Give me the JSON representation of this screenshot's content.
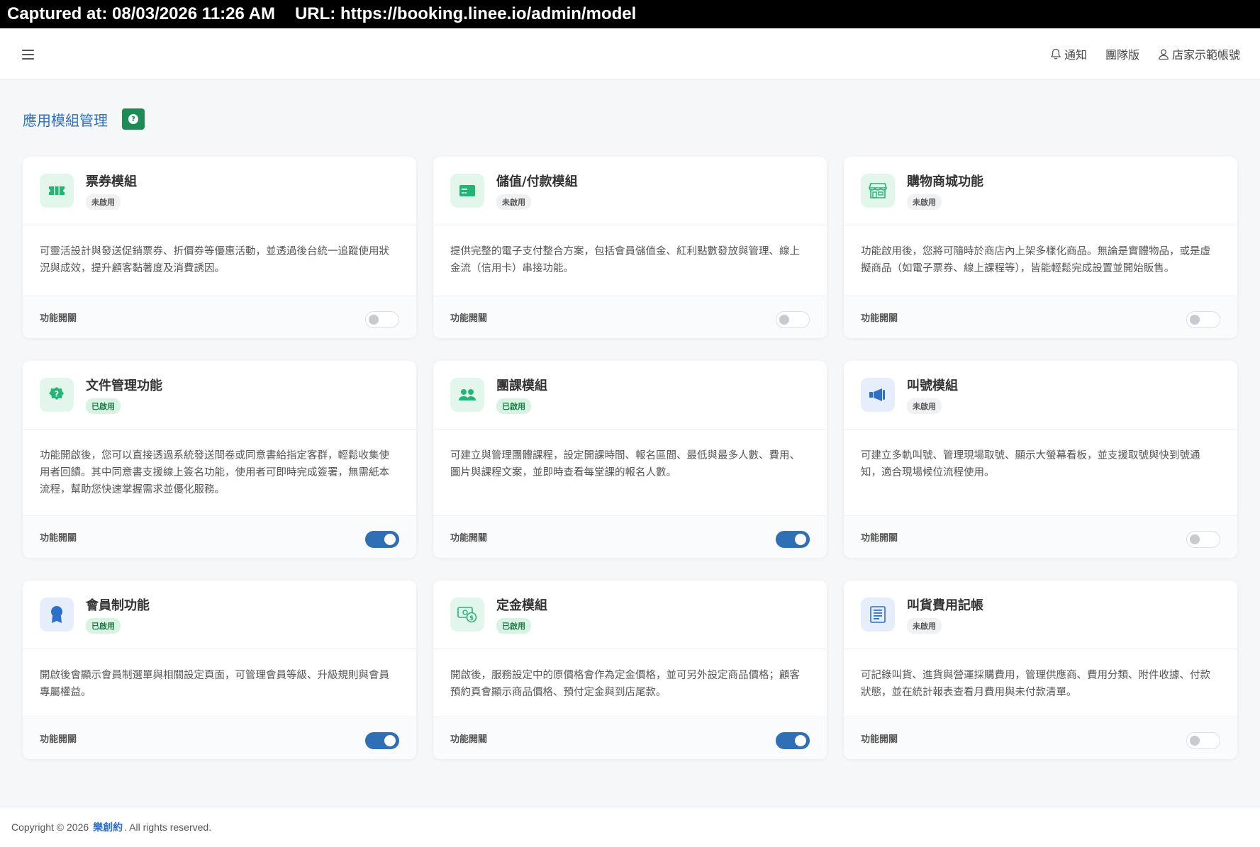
{
  "capture": {
    "captured_at": "Captured at: 08/03/2026 11:26 AM",
    "url": "URL: https://booking.linee.io/admin/model"
  },
  "topbar": {
    "notifications": "通知",
    "team": "團隊版",
    "account": "店家示範帳號"
  },
  "page": {
    "title": "應用模組管理",
    "help": "?"
  },
  "foot_label": "功能開關",
  "modules": [
    {
      "title": "票券模組",
      "status": "未啟用",
      "enabled": false,
      "icon": "ticket-icon",
      "color": "green",
      "desc": "可靈活設計與發送促銷票券、折價券等優惠活動，並透過後台統一追蹤使用狀況與成效，提升顧客黏著度及消費誘因。"
    },
    {
      "title": "儲值/付款模組",
      "status": "未啟用",
      "enabled": false,
      "icon": "payment-card-icon",
      "color": "green",
      "desc": "提供完整的電子支付整合方案，包括會員儲值金、紅利點數發放與管理、線上金流（信用卡）串接功能。"
    },
    {
      "title": "購物商城功能",
      "status": "未啟用",
      "enabled": false,
      "icon": "store-icon",
      "color": "green",
      "desc": "功能啟用後，您將可隨時於商店內上架多樣化商品。無論是實體物品，或是虛擬商品（如電子票券、線上課程等），皆能輕鬆完成設置並開始販售。"
    },
    {
      "title": "文件管理功能",
      "status": "已啟用",
      "enabled": true,
      "icon": "document-badge-icon",
      "color": "green",
      "desc": "功能開啟後，您可以直接透過系統發送問卷或同意書給指定客群，輕鬆收集使用者回饋。其中同意書支援線上簽名功能，使用者可即時完成簽署，無需紙本流程，幫助您快速掌握需求並優化服務。"
    },
    {
      "title": "團課模組",
      "status": "已啟用",
      "enabled": true,
      "icon": "group-users-icon",
      "color": "green",
      "desc": "可建立與管理團體課程，設定開課時間、報名區間、最低與最多人數、費用、圖片與課程文案，並即時查看每堂課的報名人數。"
    },
    {
      "title": "叫號模組",
      "status": "未啟用",
      "enabled": false,
      "icon": "megaphone-icon",
      "color": "blue",
      "desc": "可建立多軌叫號、管理現場取號、顯示大螢幕看板，並支援取號與快到號通知，適合現場候位流程使用。"
    },
    {
      "title": "會員制功能",
      "status": "已啟用",
      "enabled": true,
      "icon": "member-award-icon",
      "color": "blue",
      "desc": "開啟後會顯示會員制選單與相關設定頁面，可管理會員等級、升級規則與會員專屬權益。"
    },
    {
      "title": "定金模組",
      "status": "已啟用",
      "enabled": true,
      "icon": "deposit-money-icon",
      "color": "green",
      "desc": "開啟後，服務設定中的原價格會作為定金價格，並可另外設定商品價格；顧客預約頁會顯示商品價格、預付定金與到店尾款。"
    },
    {
      "title": "叫貨費用記帳",
      "status": "未啟用",
      "enabled": false,
      "icon": "ledger-icon",
      "color": "blue",
      "desc": "可記錄叫貨、進貨與營運採購費用，管理供應商、費用分類、附件收據、付款狀態，並在統計報表查看月費用與未付款清單。"
    }
  ],
  "footer": {
    "copyright": "Copyright © 2026",
    "brand": "樂創約",
    "rights": ". All rights reserved."
  }
}
